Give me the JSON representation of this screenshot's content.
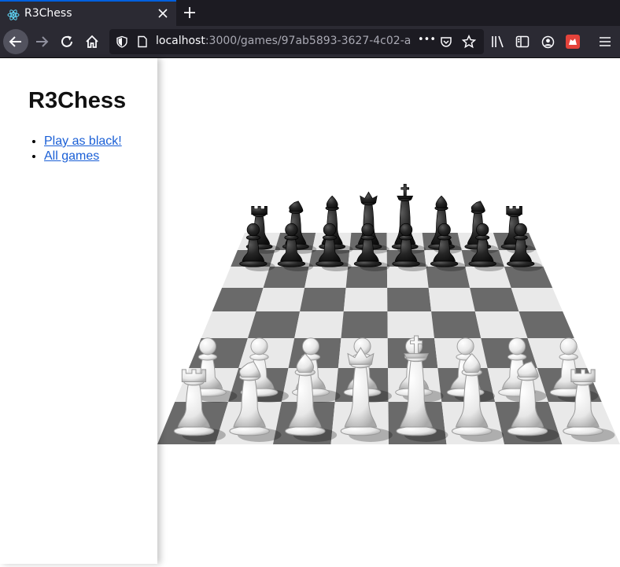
{
  "browser": {
    "tab_title": "R3Chess",
    "url_host": "localhost",
    "url_rest": ":3000/games/97ab5893-3627-4c02-a",
    "url_more": "•••"
  },
  "app": {
    "title": "R3Chess",
    "menu": [
      {
        "label": "Play as black!"
      },
      {
        "label": "All games"
      }
    ]
  },
  "board": {
    "colors": {
      "light": "#e9e9e9",
      "dark": "#6a6a6a",
      "white_piece": "#f2f2f2",
      "black_piece": "#222222"
    },
    "black_back_rank": [
      "rook",
      "knight",
      "bishop",
      "queen",
      "king",
      "bishop",
      "knight",
      "rook"
    ],
    "white_back_rank": [
      "rook",
      "knight",
      "bishop",
      "queen",
      "king",
      "bishop",
      "knight",
      "rook"
    ]
  }
}
